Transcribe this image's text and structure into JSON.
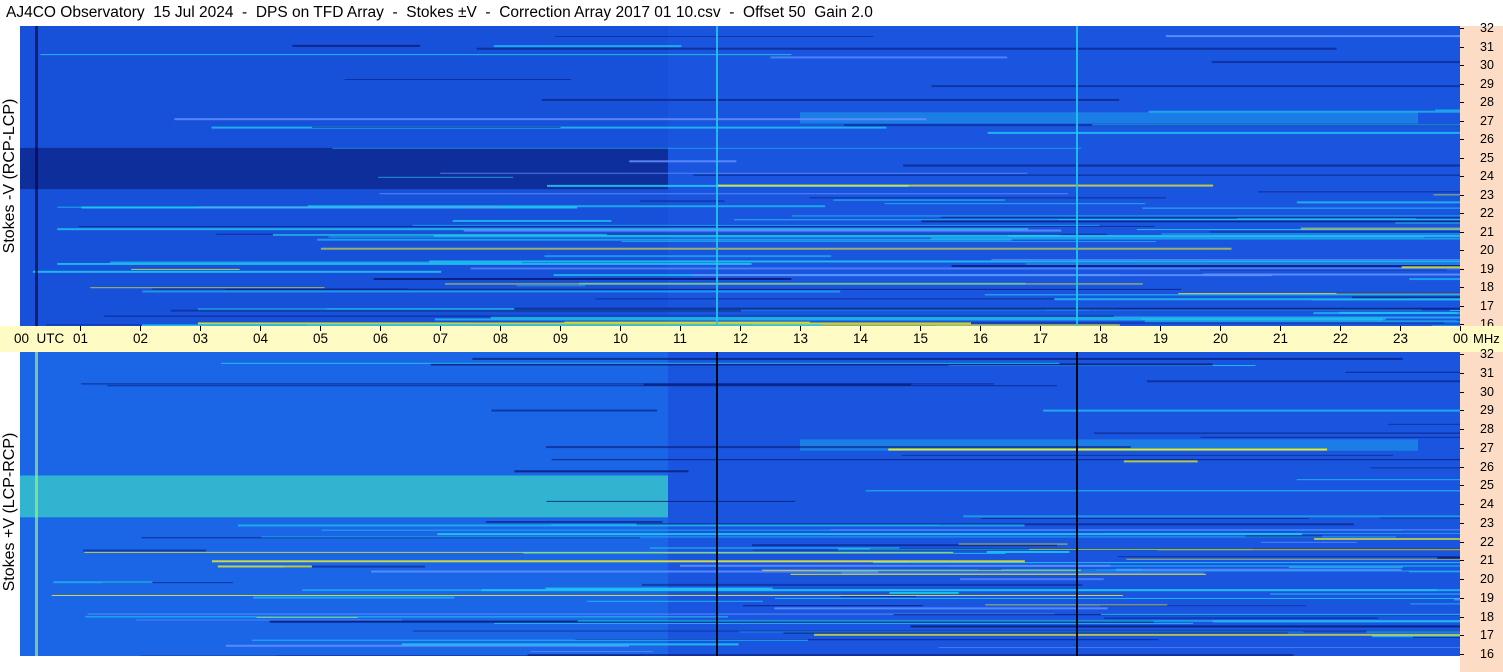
{
  "title": "AJ4CO Observatory  15 Jul 2024  -  DPS on TFD Array  -  Stokes ±V  -  Correction Array 2017 01 10.csv  -  Offset 50  Gain 2.0",
  "colors": {
    "background_blue": "#1a55e0",
    "dark_blue": "#0a1f80",
    "cyan": "#20c8f0",
    "yellow": "#f0f020",
    "freq_axis_bg": "#fcdcc4",
    "time_axis_bg": "#fefcc4"
  },
  "chart_data": [
    {
      "type": "heatmap",
      "ylabel": "Stokes -V (RCP-LCP)",
      "x_ticks": [
        "00",
        "01",
        "02",
        "03",
        "04",
        "05",
        "06",
        "07",
        "08",
        "09",
        "10",
        "11",
        "12",
        "13",
        "14",
        "15",
        "16",
        "17",
        "18",
        "19",
        "20",
        "21",
        "22",
        "23",
        "00"
      ],
      "x_unit": "UTC",
      "xlim": [
        0,
        24
      ],
      "y_ticks": [
        "32",
        "31",
        "30",
        "29",
        "28",
        "27",
        "26",
        "25",
        "24",
        "23",
        "22",
        "21",
        "20",
        "19",
        "18",
        "17",
        "16"
      ],
      "y_unit": "MHz",
      "ylim": [
        16,
        32
      ],
      "vertical_lines_utc": [
        11.6,
        17.6
      ],
      "features": [
        {
          "kind": "dark_band",
          "x": [
            0,
            10.8
          ],
          "y": [
            23.3,
            25.5
          ]
        },
        {
          "kind": "bright_band",
          "x": [
            13,
            23.3
          ],
          "y": [
            26.8,
            27.4
          ]
        }
      ]
    },
    {
      "type": "heatmap",
      "ylabel": "Stokes +V (LCP-RCP)",
      "x_ticks": [
        "00",
        "01",
        "02",
        "03",
        "04",
        "05",
        "06",
        "07",
        "08",
        "09",
        "10",
        "11",
        "12",
        "13",
        "14",
        "15",
        "16",
        "17",
        "18",
        "19",
        "20",
        "21",
        "22",
        "23",
        "00"
      ],
      "x_unit": "UTC",
      "xlim": [
        0,
        24
      ],
      "y_ticks": [
        "32",
        "31",
        "30",
        "29",
        "28",
        "27",
        "26",
        "25",
        "24",
        "23",
        "22",
        "21",
        "20",
        "19",
        "18",
        "17",
        "16"
      ],
      "y_unit": "MHz",
      "ylim": [
        16,
        32
      ],
      "vertical_lines_utc": [
        11.6,
        17.6
      ],
      "features": [
        {
          "kind": "bright_band",
          "x": [
            0,
            10.8
          ],
          "y": [
            23.3,
            25.5
          ]
        },
        {
          "kind": "bright_band",
          "x": [
            13,
            23.3
          ],
          "y": [
            26.8,
            27.4
          ]
        }
      ]
    }
  ],
  "time_axis": {
    "first_label": "00  UTC",
    "labels": [
      "01",
      "02",
      "03",
      "04",
      "05",
      "06",
      "07",
      "08",
      "09",
      "10",
      "11",
      "12",
      "13",
      "14",
      "15",
      "16",
      "17",
      "18",
      "19",
      "20",
      "21",
      "22",
      "23",
      "00"
    ],
    "unit_label": "MHz"
  }
}
